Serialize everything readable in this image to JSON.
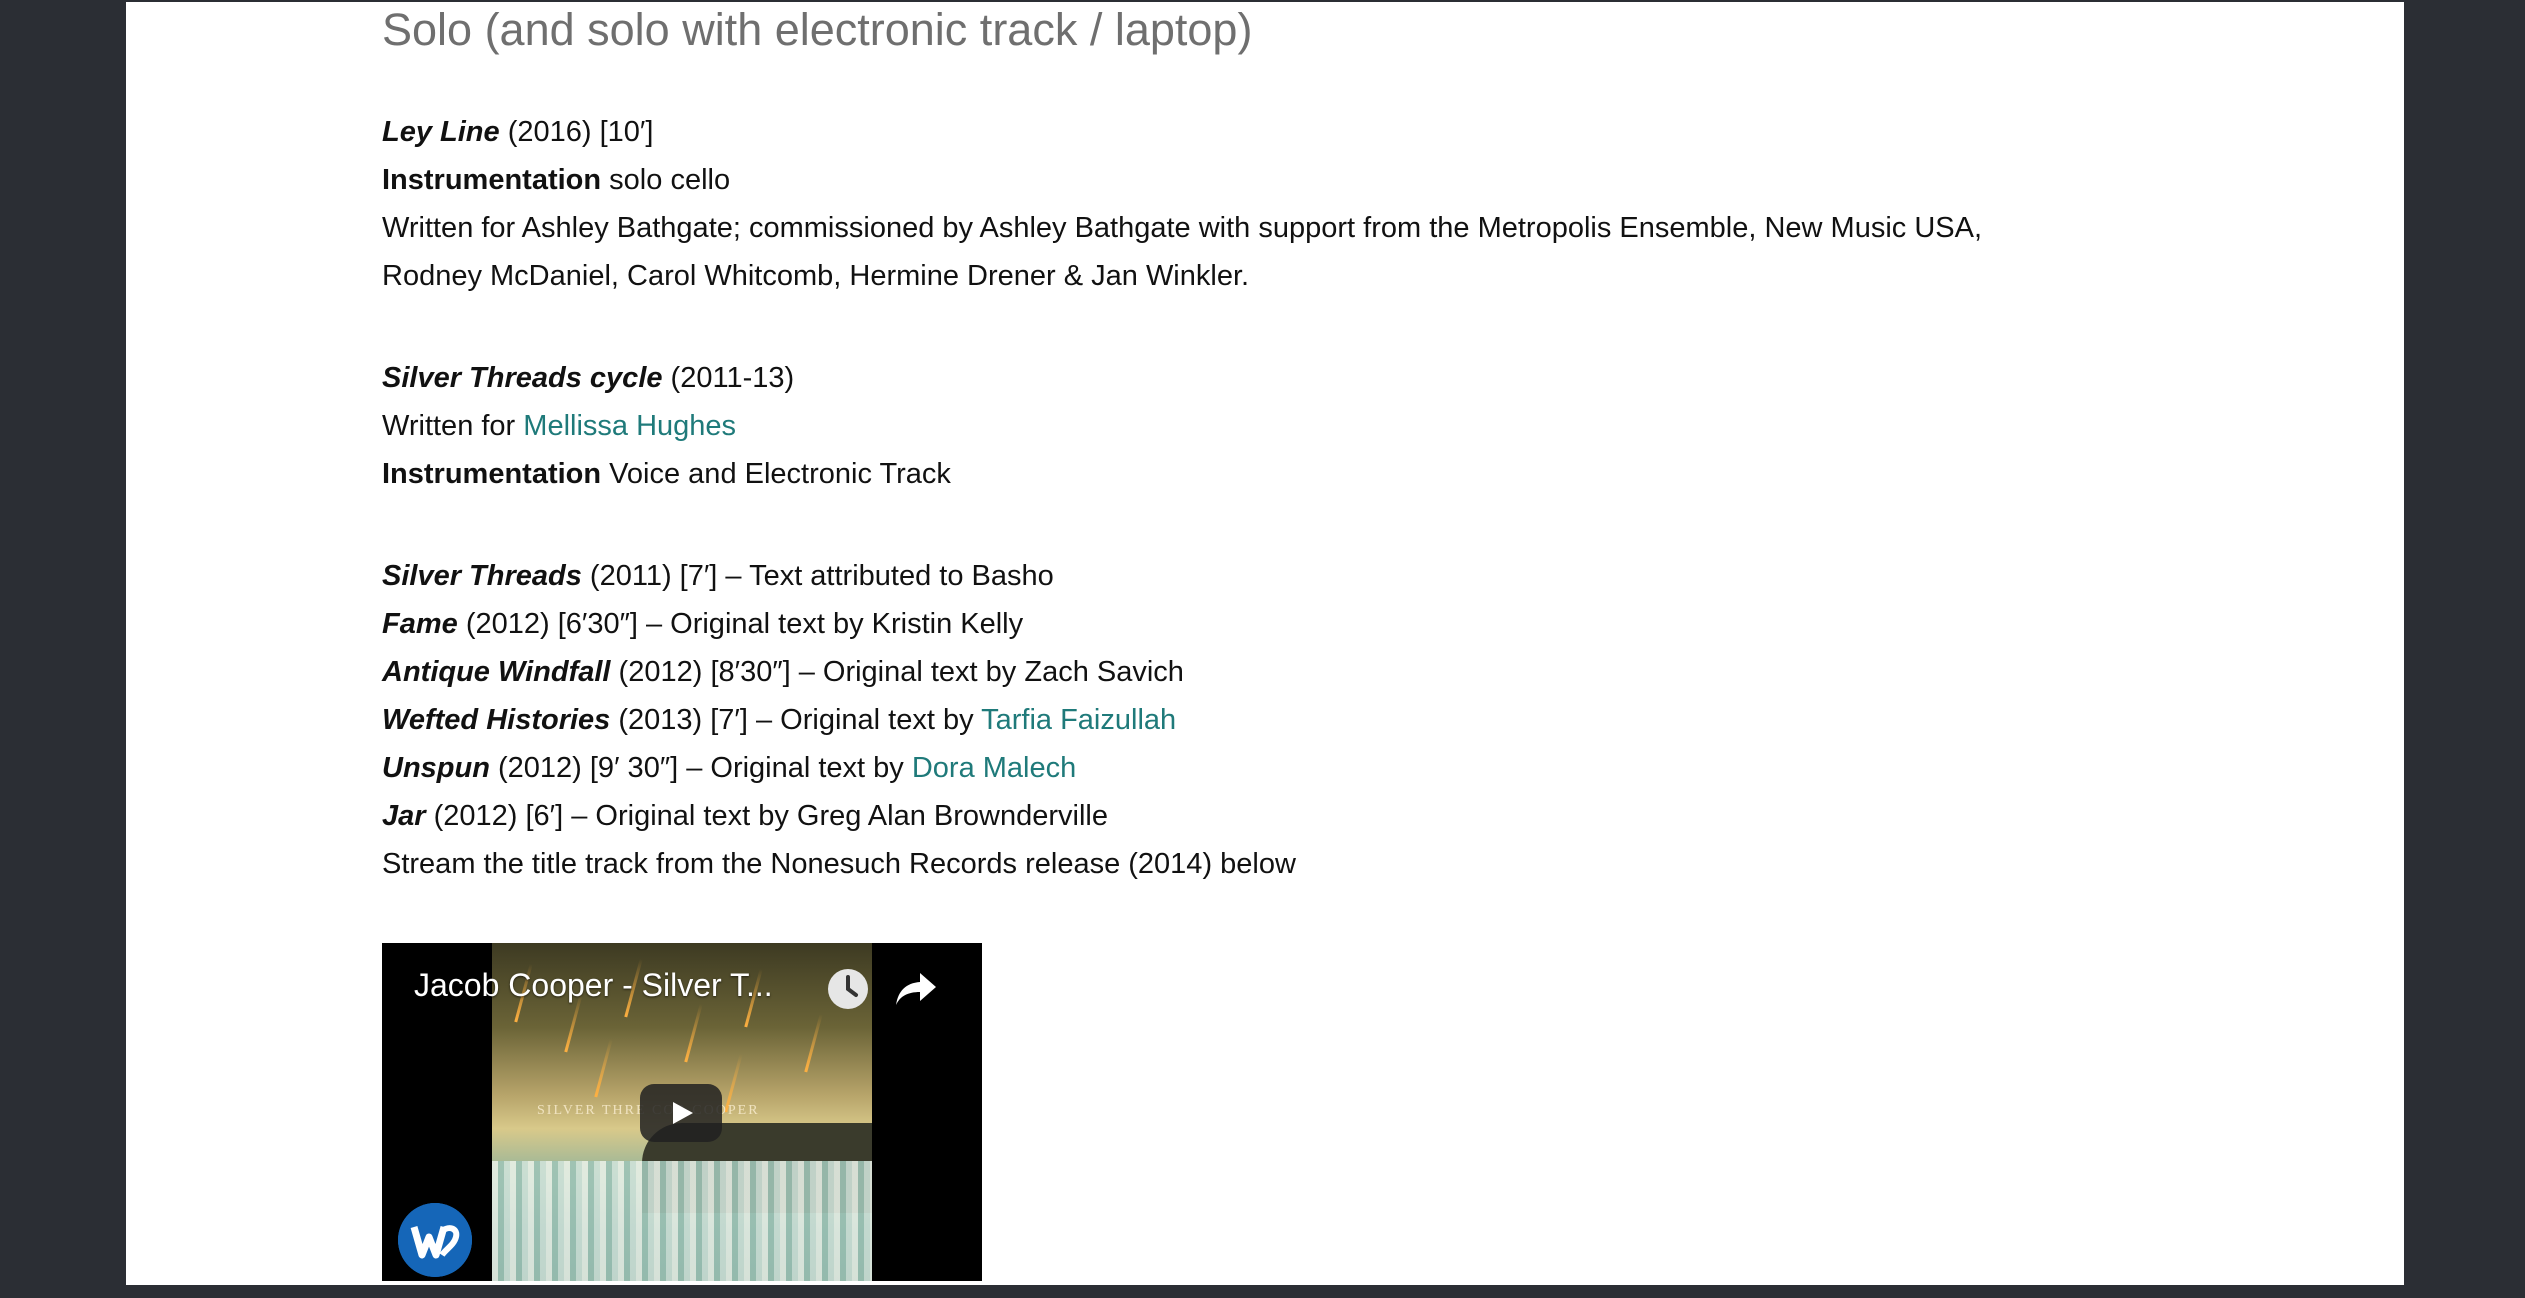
{
  "heading": "Solo (and solo with electronic track / laptop)",
  "ley_line": {
    "title": "Ley Line",
    "meta": " (2016) [10′]",
    "instr_label": "Instrumentation",
    "instr_value": " solo cello",
    "note_1": "Written for Ashley Bathgate; commissioned by Ashley Bathgate with support from the Metropolis Ensemble, New Music USA,",
    "note_2": "Rodney McDaniel, Carol Whitcomb, Hermine Drener & Jan Winkler."
  },
  "silver_cycle": {
    "title": "Silver Threads cycle",
    "meta": " (2011-13)",
    "written_for": "Written for ",
    "written_for_link": "Mellissa Hughes",
    "instr_label": "Instrumentation",
    "instr_value": " Voice and Electronic Track"
  },
  "tracks": [
    {
      "title": "Silver Threads",
      "rest": " (2011) [7′] – Text attributed to Basho",
      "link": ""
    },
    {
      "title": "Fame",
      "rest": " (2012) [6′30″] – Original text by Kristin Kelly",
      "link": ""
    },
    {
      "title": "Antique Windfall",
      "rest": " (2012) [8′30″] – Original text by Zach Savich",
      "link": ""
    },
    {
      "title": "Wefted Histories",
      "rest": " (2013) [7′] – Original text by ",
      "link": "Tarfia Faizullah"
    },
    {
      "title": "Unspun",
      "rest": " (2012) [9′ 30″] – Original text by ",
      "link": "Dora Malech"
    },
    {
      "title": "Jar",
      "rest": " (2012) [6′] – Original text by Greg Alan Brownderville",
      "link": ""
    }
  ],
  "stream_note": "Stream the title track from the Nonesuch Records release (2014) below",
  "video": {
    "title": "Jacob Cooper - Silver T...",
    "art_text": "SILVER THRE          COB COOPER",
    "watch_later_icon": "clock-icon",
    "share_icon": "share-icon",
    "play_icon": "play-icon",
    "channel_logo": "warner-logo"
  },
  "colors": {
    "background": "#2b2e34",
    "page": "#ffffff",
    "link": "#1f7a7a",
    "heading": "#6f6f6f"
  }
}
